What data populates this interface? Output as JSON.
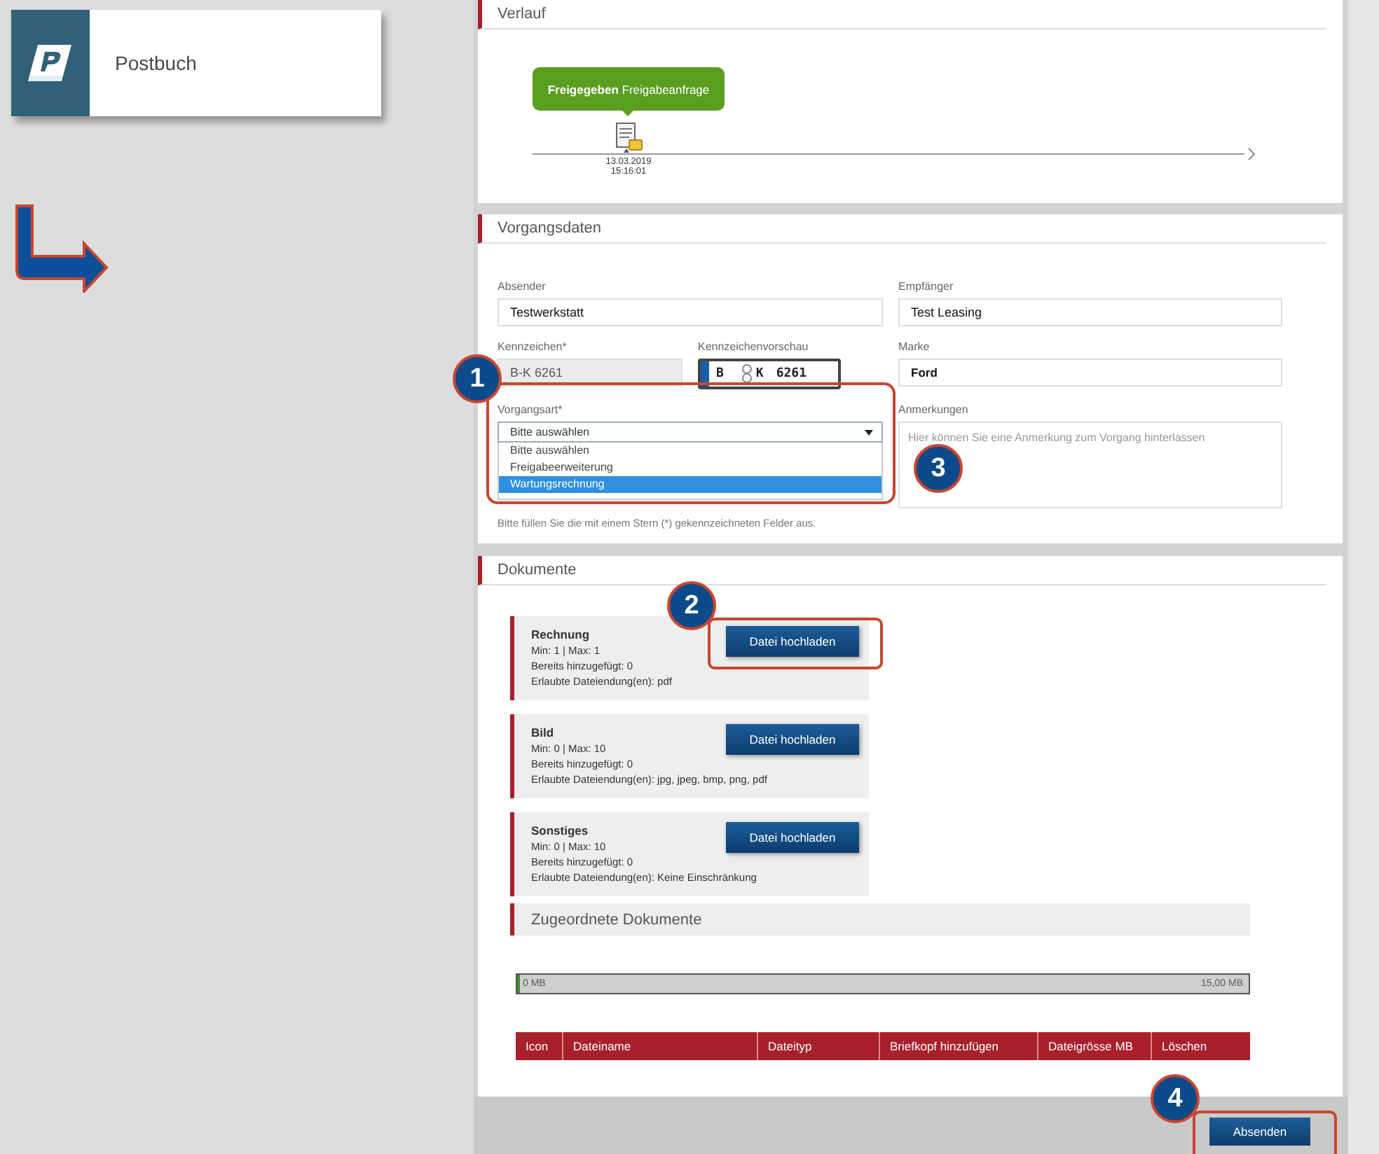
{
  "app_card": {
    "title": "Postbuch"
  },
  "verlauf": {
    "title": "Verlauf",
    "events": [
      {
        "text": "**Freigegeben** Freigabeanfrage",
        "color": "#5a9e1f",
        "date": "13.03.2019",
        "time": "15:16:01"
      }
    ]
  },
  "vorgangsdaten": {
    "title": "Vorgangsdaten",
    "absender": {
      "label": "Absender",
      "value": "Testwerkstatt"
    },
    "empfaenger": {
      "label": "Empfänger",
      "value": "Test Leasing"
    },
    "kennzeichen": {
      "label": "Kennzeichen*",
      "value": "B-K 6261",
      "disabled": true
    },
    "vorschau": {
      "label": "Kennzeichenvorschau",
      "parts": [
        "B",
        "K",
        "6261"
      ]
    },
    "marke": {
      "label": "Marke",
      "value": "Ford"
    },
    "vorgangsart": {
      "label": "Vorgangsart*",
      "value": "Bitte auswählen",
      "expanded": true,
      "options": [
        {
          "label": "Bitte auswählen",
          "highlighted": false
        },
        {
          "label": "Freigabeerweiterung",
          "highlighted": false
        },
        {
          "label": "Wartungsrechnung",
          "highlighted": true
        }
      ]
    },
    "anmerkungen": {
      "label": "Anmerkungen",
      "placeholder": "Hier können Sie eine Anmerkung zum Vorgang hinterlassen"
    },
    "hint": "Bitte füllen Sie die mit einem Stern (*) gekennzeichneten Felder aus."
  },
  "dokumente": {
    "title": "Dokumente",
    "types": [
      {
        "name": "Rechnung",
        "limits": "Min: 1 | Max: 1",
        "added": "Bereits hinzugefügt: 0",
        "extensions": "Erlaubte Dateiendung(en): pdf",
        "button": "Datei hochladen"
      },
      {
        "name": "Bild",
        "limits": "Min: 0 | Max: 10",
        "added": "Bereits hinzugefügt: 0",
        "extensions": "Erlaubte Dateiendung(en): jpg, jpeg, bmp, png, pdf",
        "button": "Datei hochladen"
      },
      {
        "name": "Sonstiges",
        "limits": "Min: 0 | Max: 10",
        "added": "Bereits hinzugefügt: 0",
        "extensions": "Erlaubte Dateiendung(en): Keine Einschränkung",
        "button": "Datei hochladen"
      }
    ],
    "assigned_title": "Zugeordnete Dokumente",
    "storage": {
      "level": 0,
      "min_label": "0 MB",
      "max_label": "15,00 MB"
    },
    "table": {
      "columns": [
        "Icon",
        "Dateiname",
        "Dateityp",
        "Briefkopf hinzufügen",
        "Dateigrösse MB",
        "Löschen"
      ]
    }
  },
  "footer": {
    "submit": "Absenden"
  },
  "callouts": [
    "1",
    "2",
    "3",
    "4"
  ]
}
